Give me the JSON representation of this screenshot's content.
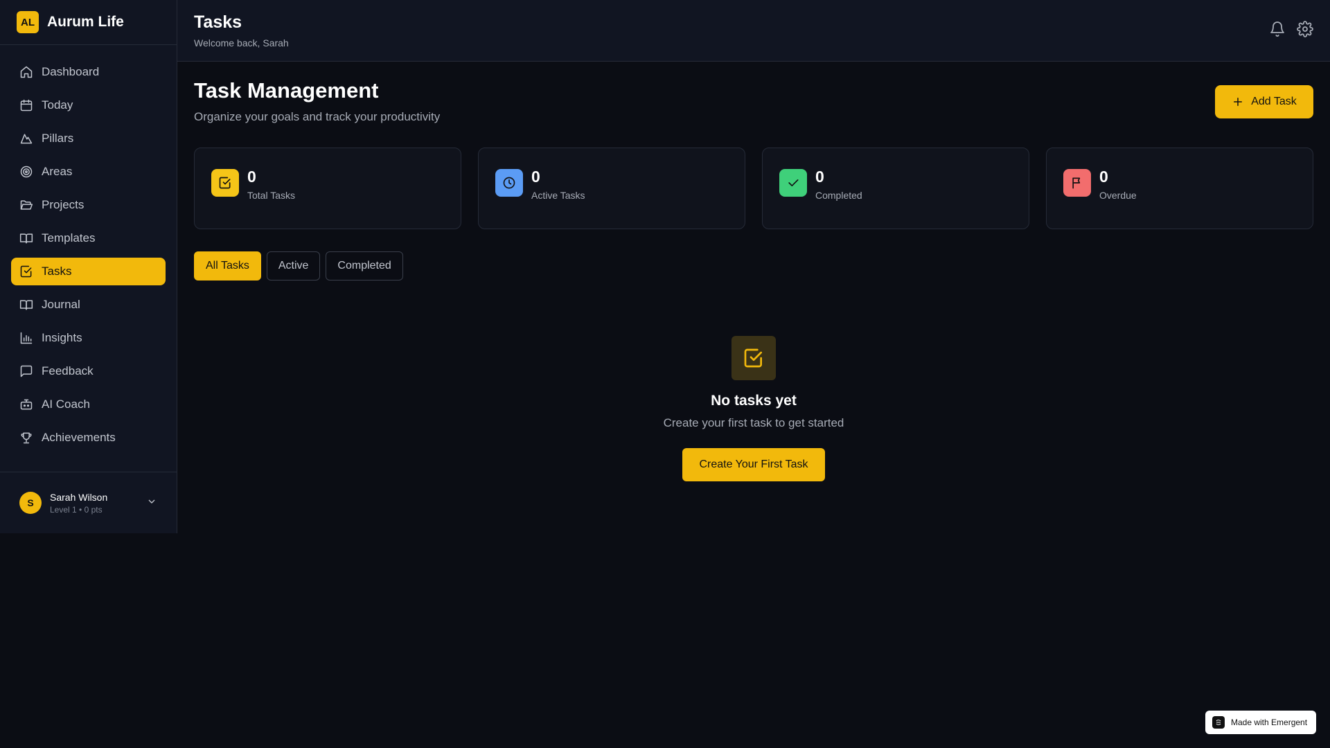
{
  "brand": {
    "logo_text": "AL",
    "name": "Aurum Life"
  },
  "sidebar": {
    "items": [
      {
        "label": "Dashboard",
        "icon": "home-icon"
      },
      {
        "label": "Today",
        "icon": "calendar-icon"
      },
      {
        "label": "Pillars",
        "icon": "mountain-icon"
      },
      {
        "label": "Areas",
        "icon": "target-icon"
      },
      {
        "label": "Projects",
        "icon": "folder-open-icon"
      },
      {
        "label": "Templates",
        "icon": "book-open-icon"
      },
      {
        "label": "Tasks",
        "icon": "check-square-icon",
        "active": true
      },
      {
        "label": "Journal",
        "icon": "book-open-icon"
      },
      {
        "label": "Insights",
        "icon": "bar-chart-icon"
      },
      {
        "label": "Feedback",
        "icon": "message-icon"
      },
      {
        "label": "AI Coach",
        "icon": "bot-icon"
      },
      {
        "label": "Achievements",
        "icon": "trophy-icon"
      }
    ],
    "user": {
      "initial": "S",
      "name": "Sarah Wilson",
      "meta": "Level 1 • 0 pts"
    }
  },
  "header": {
    "title": "Tasks",
    "subtitle": "Welcome back, Sarah"
  },
  "main": {
    "title": "Task Management",
    "subtitle": "Organize your goals and track your productivity",
    "add_button": "Add Task",
    "stats": [
      {
        "value": "0",
        "label": "Total Tasks",
        "icon": "check-square-icon",
        "color": "#f5c518"
      },
      {
        "value": "0",
        "label": "Active Tasks",
        "icon": "clock-icon",
        "color": "#5b9cf5"
      },
      {
        "value": "0",
        "label": "Completed",
        "icon": "check-icon",
        "color": "#3fd07a"
      },
      {
        "value": "0",
        "label": "Overdue",
        "icon": "flag-icon",
        "color": "#f26d6d"
      }
    ],
    "filters": [
      {
        "label": "All Tasks",
        "active": true
      },
      {
        "label": "Active"
      },
      {
        "label": "Completed"
      }
    ],
    "empty": {
      "title": "No tasks yet",
      "subtitle": "Create your first task to get started",
      "button": "Create Your First Task"
    }
  },
  "badge": {
    "text": "Made with Emergent"
  },
  "colors": {
    "accent": "#f2b90c",
    "background": "#0b0d14",
    "panel": "#111522"
  }
}
